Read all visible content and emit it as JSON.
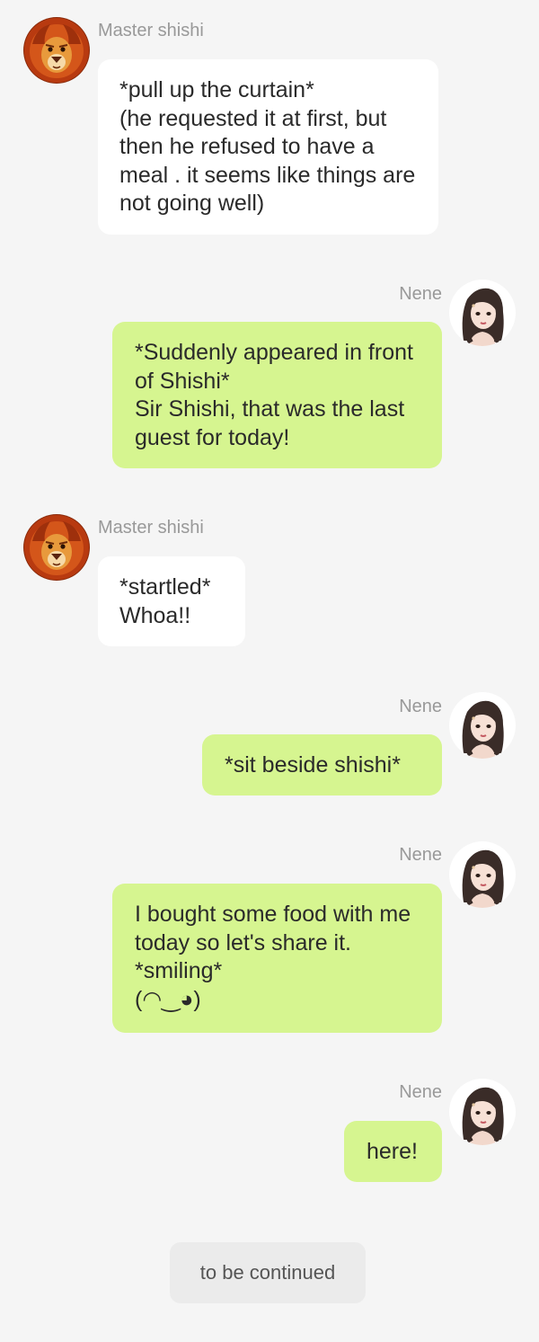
{
  "colors": {
    "background": "#f5f5f5",
    "left_bubble": "#ffffff",
    "right_bubble": "#d6f590",
    "sender_name": "#999999",
    "status_chip": "#ebebeb"
  },
  "messages": [
    {
      "sender": "Master shishi",
      "side": "left",
      "avatar": "lion-avatar-icon",
      "text": "*pull up the curtain*\n(he requested it at first, but then he refused to have a meal . it seems like things are not going well)"
    },
    {
      "sender": "Nene",
      "side": "right",
      "avatar": "girl-avatar-icon",
      "text": "*Suddenly appeared in front of Shishi*\nSir  Shishi, that was the last guest for today!"
    },
    {
      "sender": "Master shishi",
      "side": "left",
      "avatar": "lion-avatar-icon",
      "text": "*startled*\nWhoa!!"
    },
    {
      "sender": "Nene",
      "side": "right",
      "avatar": "girl-avatar-icon",
      "text": "*sit beside shishi*"
    },
    {
      "sender": "Nene",
      "side": "right",
      "avatar": "girl-avatar-icon",
      "text": "I bought some food with me today so let's share it.\n*smiling*\n(◠‿◕)"
    },
    {
      "sender": "Nene",
      "side": "right",
      "avatar": "girl-avatar-icon",
      "text": "here!"
    }
  ],
  "footer": {
    "status_label": "to be continued"
  }
}
